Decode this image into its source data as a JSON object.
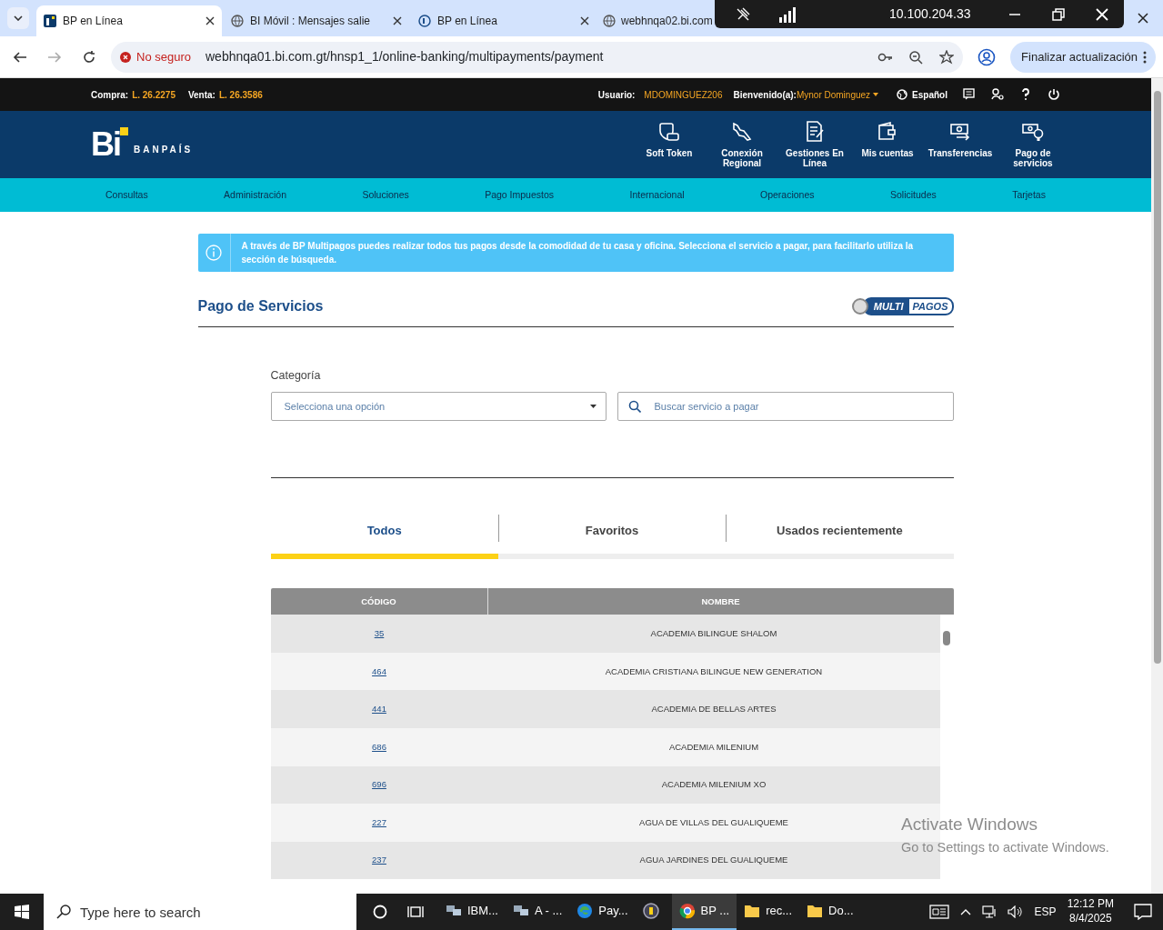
{
  "browser": {
    "tabs": [
      {
        "title": "BP en Línea",
        "selected": true
      },
      {
        "title": "BI Móvil : Mensajes salie",
        "selected": false
      },
      {
        "title": "BP en Línea",
        "selected": false
      },
      {
        "title": "webhnqa02.bi.com",
        "selected": false
      }
    ],
    "security": "No seguro",
    "url": "webhnqa01.bi.com.gt/hnsp1_1/online-banking/multipayments/payment",
    "update_button": "Finalizar actualización"
  },
  "remote_bar": {
    "host": "10.100.204.33"
  },
  "topbar": {
    "compra_label": "Compra:",
    "compra_value": "L. 26.2275",
    "venta_label": "Venta:",
    "venta_value": "L. 26.3586",
    "usuario_label": "Usuario:",
    "usuario_value": "MDOMINGUEZ206",
    "welcome_label": "Bienvenido(a):",
    "welcome_user": "Mynor Dominguez",
    "language": "Español"
  },
  "header": {
    "logo_mark": "Bi",
    "logo_text": "BANPAÍS",
    "quick_links": [
      {
        "label": "Soft Token"
      },
      {
        "label": "Conexión Regional"
      },
      {
        "label": "Gestiones En Línea"
      },
      {
        "label": "Mis cuentas"
      },
      {
        "label": "Transferencias"
      },
      {
        "label": "Pago de servicios"
      }
    ]
  },
  "nav": [
    "Consultas",
    "Administración",
    "Soluciones",
    "Pago Impuestos",
    "Internacional",
    "Operaciones",
    "Solicitudes",
    "Tarjetas"
  ],
  "info_alert": "A través de BP Multipagos puedes realizar todos tus pagos desde la comodidad de tu casa y oficina. Selecciona el servicio a pagar, para facilitarlo utiliza la sección de búsqueda.",
  "section": {
    "title": "Pago de Servicios",
    "logo_left": "MULTI",
    "logo_right": "PAGOS"
  },
  "filters": {
    "category_label": "Categoría",
    "category_placeholder": "Selecciona una opción",
    "search_placeholder": "Buscar servicio a pagar"
  },
  "tabs": [
    {
      "label": "Todos",
      "selected": true
    },
    {
      "label": "Favoritos",
      "selected": false
    },
    {
      "label": "Usados recientemente",
      "selected": false
    }
  ],
  "table": {
    "columns": [
      "CÓDIGO",
      "NOMBRE"
    ],
    "rows": [
      {
        "code": "35",
        "name": "ACADEMIA BILINGUE SHALOM"
      },
      {
        "code": "464",
        "name": "ACADEMIA CRISTIANA BILINGUE NEW GENERATION"
      },
      {
        "code": "441",
        "name": "ACADEMIA DE BELLAS ARTES"
      },
      {
        "code": "686",
        "name": "ACADEMIA MILENIUM"
      },
      {
        "code": "696",
        "name": "ACADEMIA MILENIUM XO"
      },
      {
        "code": "227",
        "name": "AGUA DE VILLAS DEL GUALIQUEME"
      },
      {
        "code": "237",
        "name": "AGUA JARDINES DEL GUALIQUEME"
      }
    ]
  },
  "activation": {
    "title": "Activate Windows",
    "subtitle": "Go to Settings to activate Windows."
  },
  "taskbar": {
    "search_placeholder": "Type here to search",
    "apps": [
      {
        "label": "IBM...",
        "selected": false
      },
      {
        "label": "A - ...",
        "selected": false
      },
      {
        "label": "Pay...",
        "selected": false
      },
      {
        "selected": false
      },
      {
        "label": "BP ...",
        "selected": true
      },
      {
        "label": "rec...",
        "selected": false
      },
      {
        "label": "Do...",
        "selected": false
      }
    ],
    "language": "ESP",
    "time": "12:12 PM",
    "date": "8/4/2025"
  }
}
